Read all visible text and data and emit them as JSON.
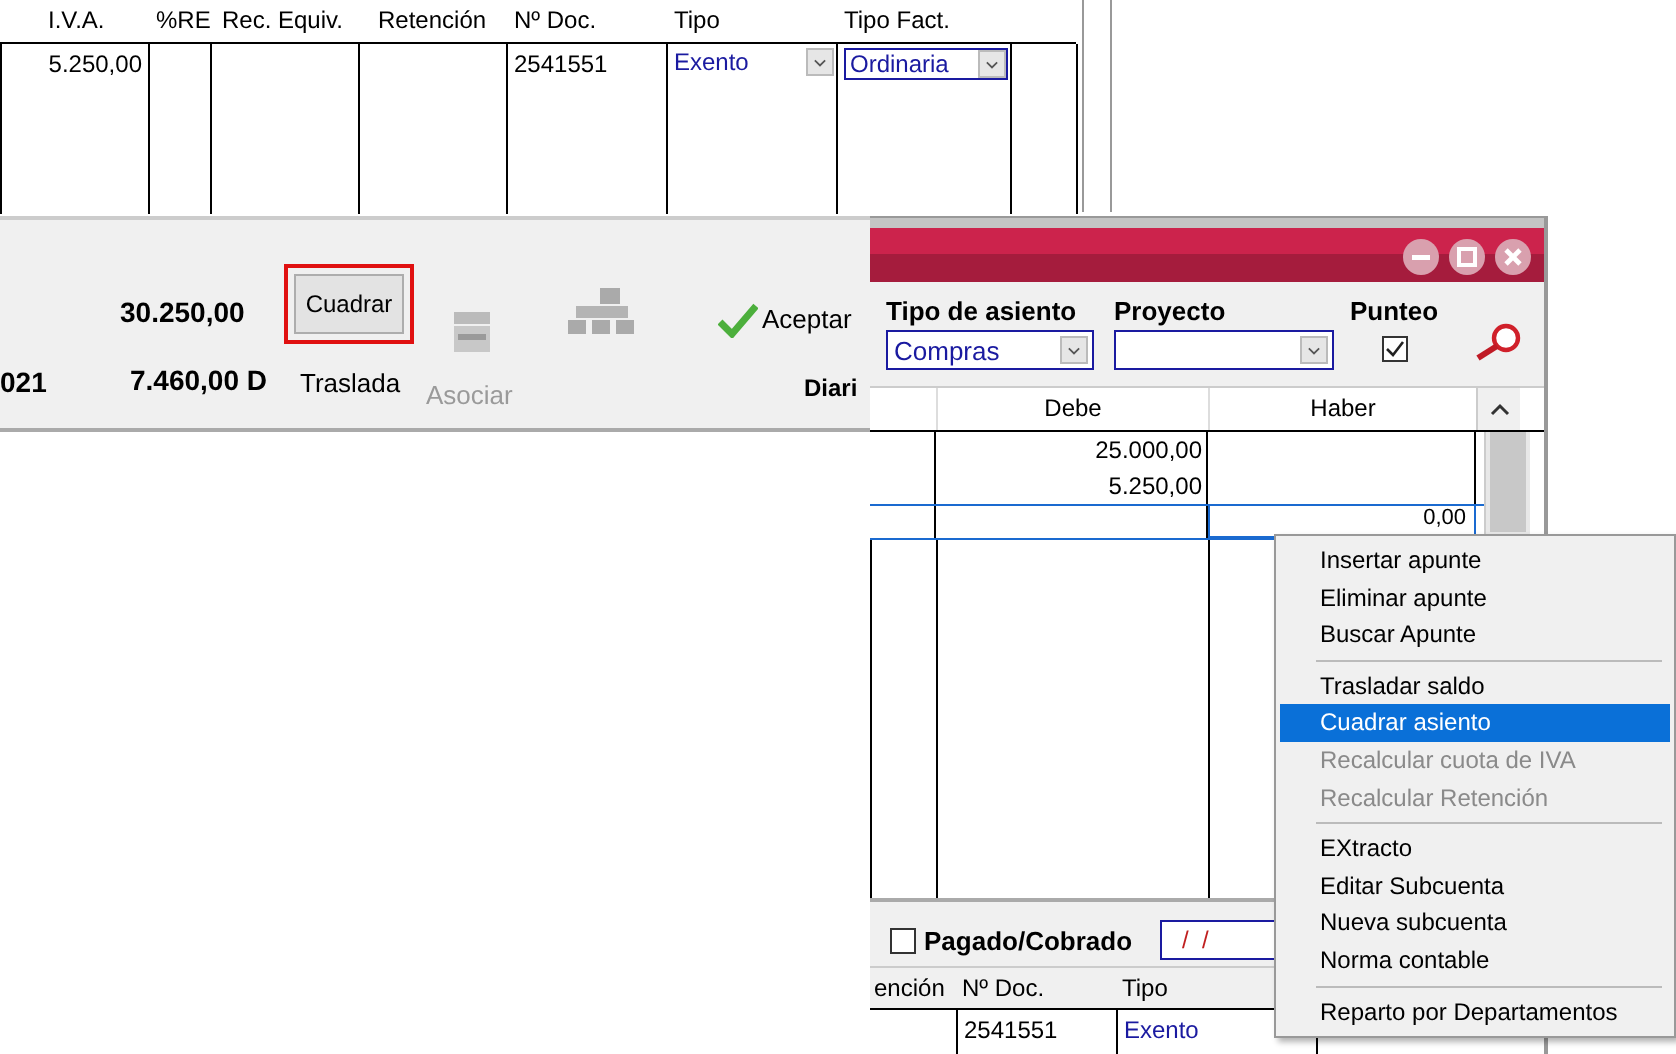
{
  "back_window": {
    "table": {
      "columns": [
        "I.V.A.",
        "%RE",
        "Rec. Equiv.",
        "Retención",
        "Nº Doc.",
        "Tipo",
        "Tipo Fact."
      ],
      "rows": [
        {
          "iva": "5.250,00",
          "doc": "2541551",
          "tipo": "Exento",
          "tipo_fact": "Ordinaria"
        }
      ]
    },
    "footer": {
      "total": "30.250,00",
      "period": "021",
      "balance": "7.460,00 D",
      "cuadrar": {
        "label": "Cuadrar",
        "highlighted": true
      },
      "traslada": "Traslada",
      "asociar": {
        "label": "Asociar",
        "disabled": true
      },
      "aceptar": "Aceptar",
      "diario": "Diari"
    }
  },
  "front_window": {
    "fields": {
      "tipo_de_asiento": {
        "label": "Tipo de asiento",
        "value": "Compras"
      },
      "proyecto": {
        "label": "Proyecto"
      },
      "punteo": {
        "label": "Punteo",
        "checked": true
      }
    },
    "table": {
      "columns": [
        "Debe",
        "Haber"
      ],
      "rows": [
        {
          "debe": "25.000,00",
          "selected": false
        },
        {
          "debe": "5.250,00",
          "selected": false
        },
        {
          "haber": "0,00",
          "selected": true
        }
      ]
    },
    "pagado": {
      "label": "Pagado/Cobrado",
      "checked": false,
      "date": "/  /"
    },
    "lower_table": {
      "columns": [
        "ención",
        "Nº Doc.",
        "Tipo"
      ],
      "rows": [
        {
          "doc": "2541551",
          "tipo": "Exento"
        }
      ]
    }
  },
  "context_menu": {
    "groups": [
      [
        {
          "label": "Insertar apunte",
          "selected": false,
          "disabled": false
        },
        {
          "label": "Eliminar apunte",
          "selected": false,
          "disabled": false
        },
        {
          "label": "Buscar Apunte",
          "selected": false,
          "disabled": false
        }
      ],
      [
        {
          "label": "Trasladar saldo",
          "selected": false,
          "disabled": false
        },
        {
          "label": "Cuadrar asiento",
          "selected": true,
          "disabled": false
        },
        {
          "label": "Recalcular cuota de IVA",
          "selected": false,
          "disabled": true
        },
        {
          "label": "Recalcular Retención",
          "selected": false,
          "disabled": true
        }
      ],
      [
        {
          "label": "EXtracto",
          "selected": false,
          "disabled": false
        },
        {
          "label": "Editar Subcuenta",
          "selected": false,
          "disabled": false
        },
        {
          "label": "Nueva subcuenta",
          "selected": false,
          "disabled": false
        },
        {
          "label": "Norma contable",
          "selected": false,
          "disabled": false
        }
      ],
      [
        {
          "label": "Reparto por Departamentos",
          "selected": false,
          "disabled": false
        }
      ]
    ]
  }
}
